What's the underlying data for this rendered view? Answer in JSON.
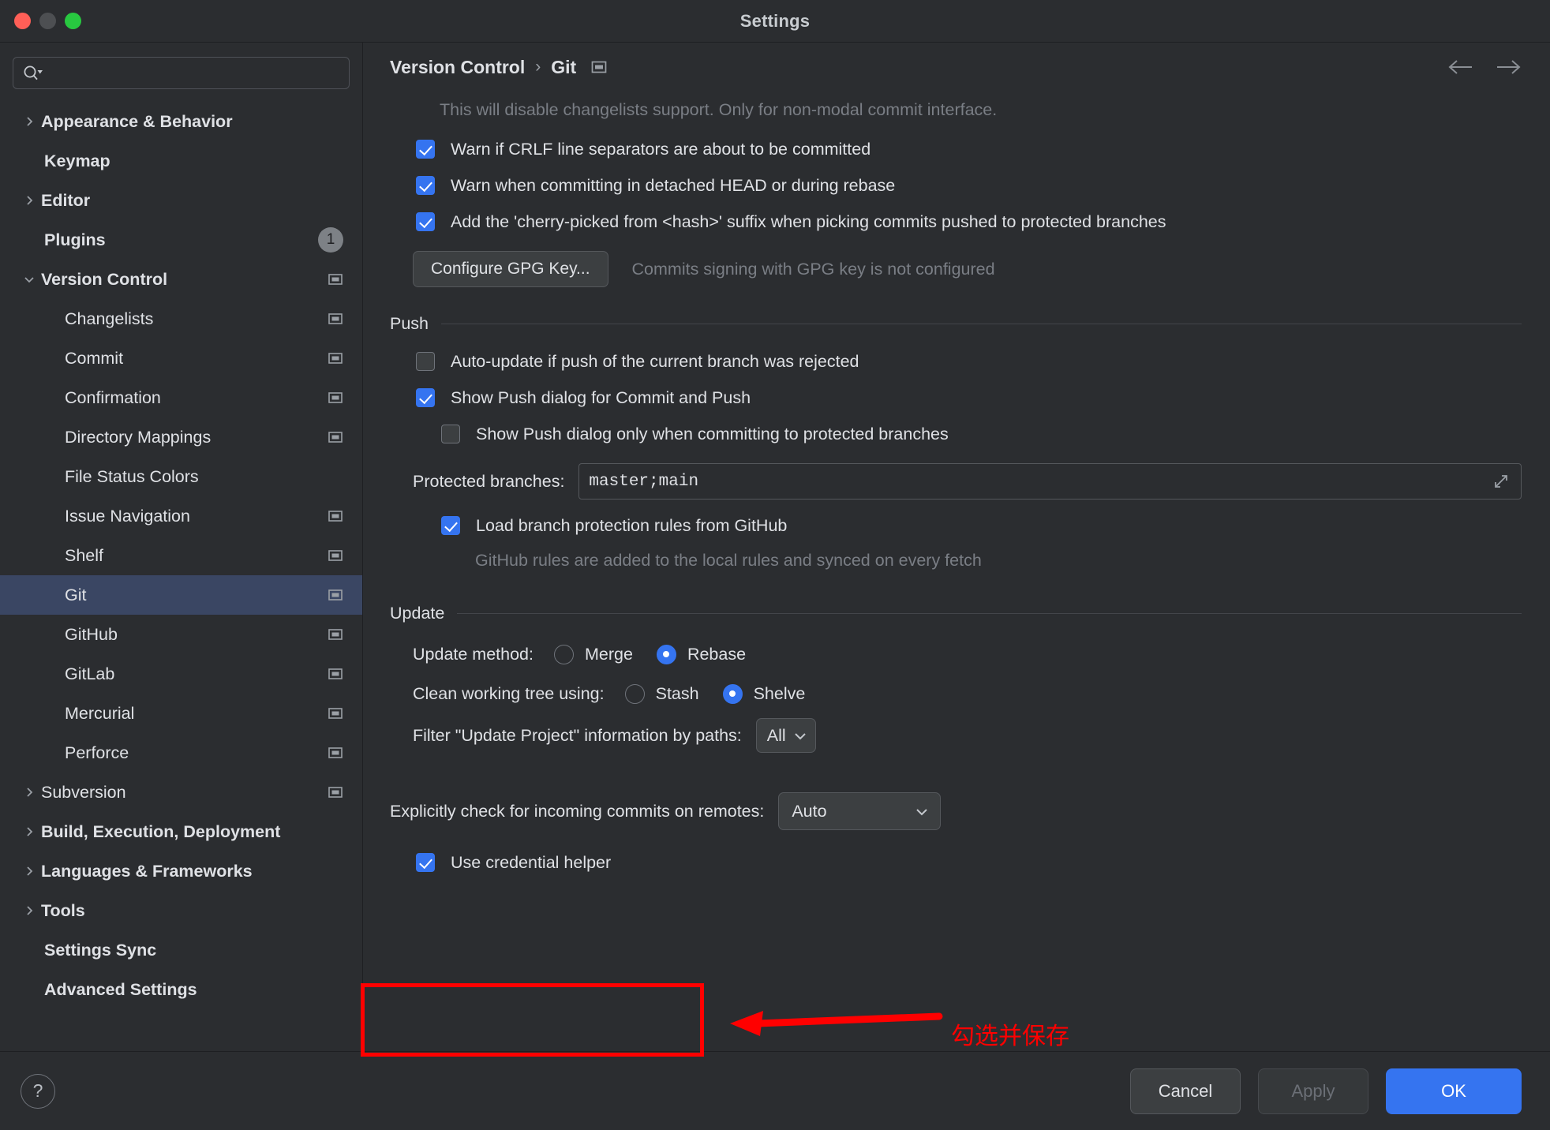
{
  "window": {
    "title": "Settings",
    "traffic_lights": [
      "close-red",
      "minimize-yellow",
      "maximize-green"
    ]
  },
  "sidebar": {
    "search": {
      "placeholder": "",
      "value": "",
      "icon": "search-dropdown-icon"
    },
    "items": [
      {
        "label": "Appearance & Behavior",
        "level": 0,
        "bold": true,
        "arrow": "chevron-right",
        "trailing": null
      },
      {
        "label": "Keymap",
        "level": 0,
        "bold": true,
        "arrow": null,
        "trailing": null
      },
      {
        "label": "Editor",
        "level": 0,
        "bold": true,
        "arrow": "chevron-right",
        "trailing": null
      },
      {
        "label": "Plugins",
        "level": 0,
        "bold": true,
        "arrow": null,
        "trailing": "badge",
        "badge": "1"
      },
      {
        "label": "Version Control",
        "level": 0,
        "bold": true,
        "arrow": "chevron-down",
        "trailing": "project-icon"
      },
      {
        "label": "Changelists",
        "level": 1,
        "bold": false,
        "arrow": null,
        "trailing": "project-icon"
      },
      {
        "label": "Commit",
        "level": 1,
        "bold": false,
        "arrow": null,
        "trailing": "project-icon"
      },
      {
        "label": "Confirmation",
        "level": 1,
        "bold": false,
        "arrow": null,
        "trailing": "project-icon"
      },
      {
        "label": "Directory Mappings",
        "level": 1,
        "bold": false,
        "arrow": null,
        "trailing": "project-icon"
      },
      {
        "label": "File Status Colors",
        "level": 1,
        "bold": false,
        "arrow": null,
        "trailing": null
      },
      {
        "label": "Issue Navigation",
        "level": 1,
        "bold": false,
        "arrow": null,
        "trailing": "project-icon"
      },
      {
        "label": "Shelf",
        "level": 1,
        "bold": false,
        "arrow": null,
        "trailing": "project-icon"
      },
      {
        "label": "Git",
        "level": 1,
        "bold": false,
        "arrow": null,
        "trailing": "project-icon",
        "selected": true
      },
      {
        "label": "GitHub",
        "level": 1,
        "bold": false,
        "arrow": null,
        "trailing": "project-icon"
      },
      {
        "label": "GitLab",
        "level": 1,
        "bold": false,
        "arrow": null,
        "trailing": "project-icon"
      },
      {
        "label": "Mercurial",
        "level": 1,
        "bold": false,
        "arrow": null,
        "trailing": "project-icon"
      },
      {
        "label": "Perforce",
        "level": 1,
        "bold": false,
        "arrow": null,
        "trailing": "project-icon"
      },
      {
        "label": "Subversion",
        "level": 1,
        "bold": false,
        "arrow": "chevron-right",
        "trailing": "project-icon"
      },
      {
        "label": "Build, Execution, Deployment",
        "level": 0,
        "bold": true,
        "arrow": "chevron-right",
        "trailing": null
      },
      {
        "label": "Languages & Frameworks",
        "level": 0,
        "bold": true,
        "arrow": "chevron-right",
        "trailing": null
      },
      {
        "label": "Tools",
        "level": 0,
        "bold": true,
        "arrow": "chevron-right",
        "trailing": null
      },
      {
        "label": "Settings Sync",
        "level": 0,
        "bold": true,
        "arrow": null,
        "trailing": null
      },
      {
        "label": "Advanced Settings",
        "level": 0,
        "bold": true,
        "arrow": null,
        "trailing": null
      }
    ],
    "selected_index": 12
  },
  "breadcrumb": {
    "root": "Version Control",
    "separator": "›",
    "current": "Git",
    "icon": "project-scope-icon",
    "back_icon": "arrow-left-icon",
    "forward_icon": "arrow-right-icon"
  },
  "main": {
    "top_hint": "This will disable changelists support. Only for non-modal commit interface.",
    "checkboxes_top": [
      {
        "label": "Warn if CRLF line separators are about to be committed",
        "checked": true
      },
      {
        "label": "Warn when committing in detached HEAD or during rebase",
        "checked": true
      },
      {
        "label": "Add the 'cherry-picked from <hash>' suffix when picking commits pushed to protected branches",
        "checked": true
      }
    ],
    "gpg": {
      "button_label": "Configure GPG Key...",
      "status": "Commits signing with GPG key is not configured"
    },
    "push": {
      "section_title": "Push",
      "auto_update": {
        "label": "Auto-update if push of the current branch was rejected",
        "checked": false
      },
      "show_push_dialog": {
        "label": "Show Push dialog for Commit and Push",
        "checked": true
      },
      "show_push_dialog_protected": {
        "label": "Show Push dialog only when committing to protected branches",
        "checked": false
      },
      "protected_branches_label": "Protected branches:",
      "protected_branches_value": "master;main",
      "expand_icon": "expand-icon",
      "load_rules": {
        "label": "Load branch protection rules from GitHub",
        "checked": true
      },
      "load_rules_hint": "GitHub rules are added to the local rules and synced on every fetch"
    },
    "update": {
      "section_title": "Update",
      "method_label": "Update method:",
      "method_options": [
        "Merge",
        "Rebase"
      ],
      "method_selected": "Rebase",
      "clean_label": "Clean working tree using:",
      "clean_options": [
        "Stash",
        "Shelve"
      ],
      "clean_selected": "Shelve",
      "filter_label": "Filter \"Update Project\" information by paths:",
      "filter_value": "All"
    },
    "incoming": {
      "label": "Explicitly check for incoming commits on remotes:",
      "value": "Auto"
    },
    "credential_helper": {
      "label": "Use credential helper",
      "checked": true
    }
  },
  "footer": {
    "help_label": "?",
    "cancel_label": "Cancel",
    "apply_label": "Apply",
    "ok_label": "OK",
    "apply_disabled": true
  },
  "annotations": {
    "note_text": "勾选并保存",
    "color": "#ff0000",
    "arrow": "left-arrow-annotation",
    "highlight_box": "use-credential-helper-highlight"
  }
}
